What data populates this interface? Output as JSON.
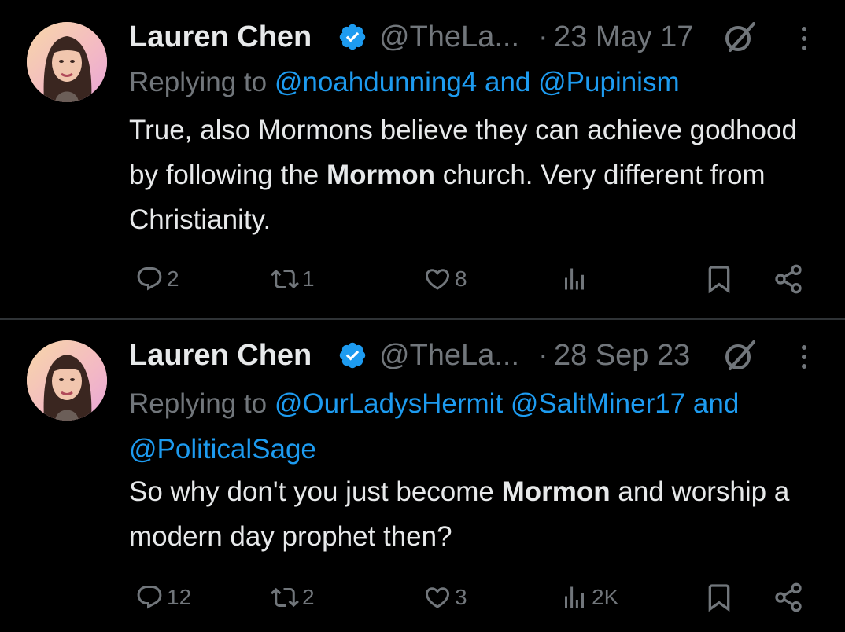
{
  "colors": {
    "background": "#000000",
    "text": "#e7e9ea",
    "muted": "#71767b",
    "accent": "#1d9bf0",
    "divider": "#2f3336"
  },
  "tweets": [
    {
      "author_name": "Lauren Chen",
      "handle": "@TheLa...",
      "separator": "·",
      "date": "23 May 17",
      "replying_prefix": "Replying to",
      "mentions": [
        "@noahdunning4",
        "@Pupinism"
      ],
      "mention_joiners": [
        "",
        " and "
      ],
      "body_segments": [
        {
          "text": "True, also Mormons believe they can achieve godhood by following the ",
          "bold": false
        },
        {
          "text": "Mormon",
          "bold": true
        },
        {
          "text": " church. Very different from Christianity.",
          "bold": false
        }
      ],
      "reply_count": "2",
      "retweet_count": "1",
      "like_count": "8",
      "view_count": "",
      "icons": [
        "verified-badge-icon",
        "edited-icon",
        "more-icon",
        "reply-icon",
        "retweet-icon",
        "like-icon",
        "views-icon",
        "bookmark-icon",
        "share-icon"
      ]
    },
    {
      "author_name": "Lauren Chen",
      "handle": "@TheLa...",
      "separator": "·",
      "date": "28 Sep 23",
      "replying_prefix": "Replying to",
      "mentions": [
        "@OurLadysHermit",
        "@SaltMiner17",
        "@PoliticalSage"
      ],
      "mention_joiners": [
        "",
        " ",
        " and "
      ],
      "body_segments": [
        {
          "text": "So why don't you just become ",
          "bold": false
        },
        {
          "text": "Mormon",
          "bold": true
        },
        {
          "text": " and worship a modern day prophet then?",
          "bold": false
        }
      ],
      "reply_count": "12",
      "retweet_count": "2",
      "like_count": "3",
      "view_count": "2K",
      "icons": [
        "verified-badge-icon",
        "edited-icon",
        "more-icon",
        "reply-icon",
        "retweet-icon",
        "like-icon",
        "views-icon",
        "bookmark-icon",
        "share-icon"
      ]
    }
  ]
}
